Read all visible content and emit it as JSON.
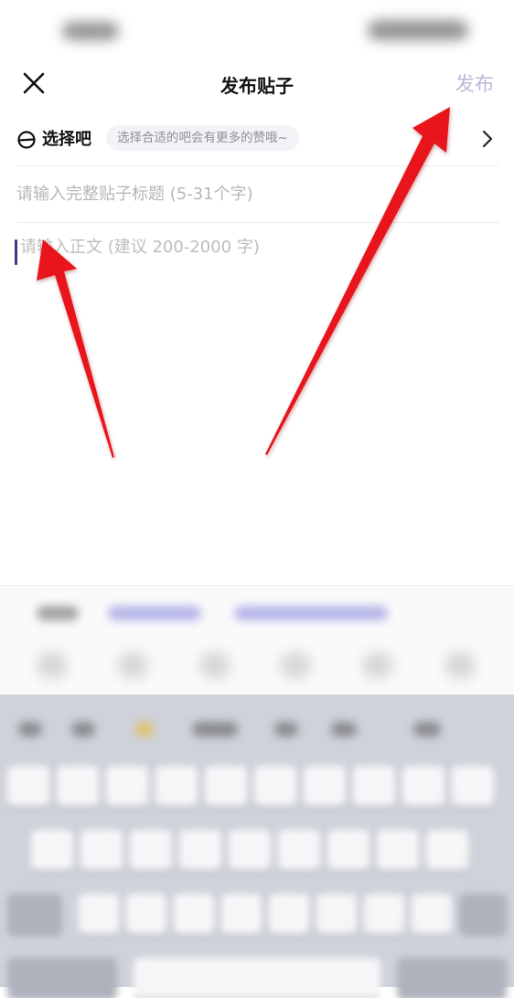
{
  "nav": {
    "title": "发布贴子",
    "publish_label": "发布"
  },
  "forum": {
    "label": "选择吧",
    "hint": "选择合适的吧会有更多的赞哦~"
  },
  "editor": {
    "title_placeholder": "请输入完整贴子标题 (5-31个字)",
    "body_placeholder": "请输入正文 (建议 200-2000 字)"
  },
  "colors": {
    "publish_disabled": "#b9b9d6",
    "annotation_arrow": "#e8161c",
    "caret": "#3b3d86"
  },
  "icons": {
    "close": "close-icon",
    "forum": "forum-circle-icon",
    "chevron": "chevron-right-icon"
  }
}
